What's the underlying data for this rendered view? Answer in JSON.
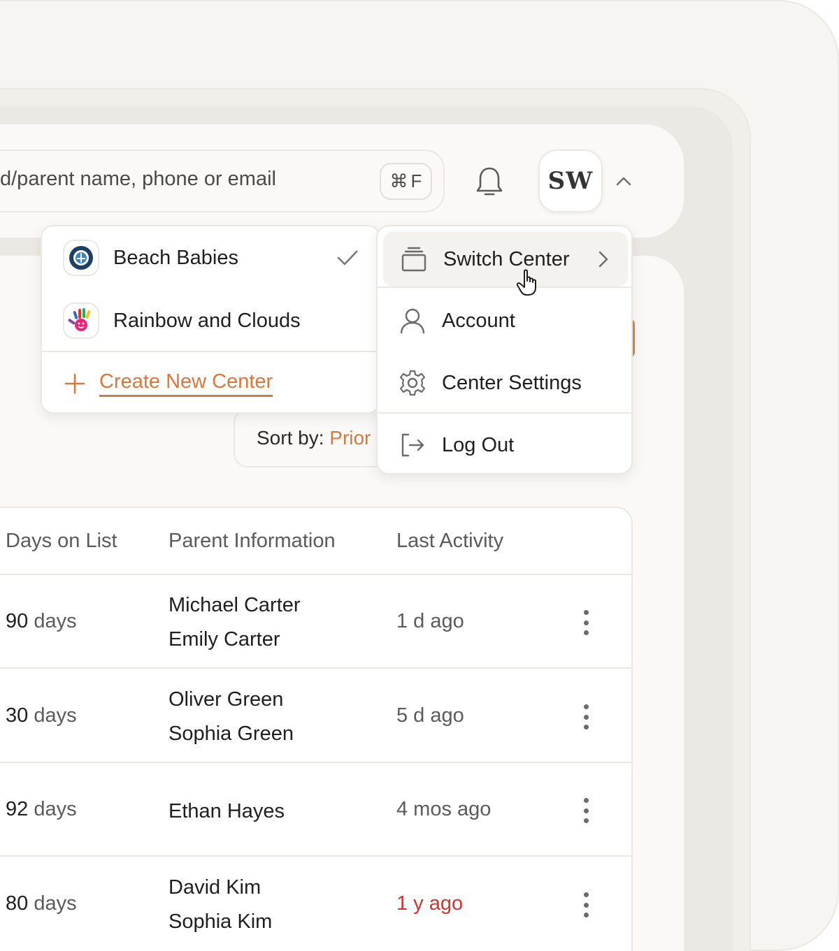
{
  "header": {
    "search_text": "d/parent name, phone or email",
    "shortcut_symbol": "⌘",
    "shortcut_key": "F",
    "avatar_initials": "SW"
  },
  "sort": {
    "label": "Sort by: ",
    "value": "Prior"
  },
  "centers_menu": {
    "items": [
      {
        "name": "Beach Babies",
        "selected": true
      },
      {
        "name": "Rainbow and Clouds",
        "selected": false
      }
    ],
    "create_label": "Create New Center"
  },
  "account_menu": {
    "items": [
      {
        "label": "Switch Center",
        "icon": "stack-icon",
        "active": true
      },
      {
        "label": "Account",
        "icon": "user-icon"
      },
      {
        "label": "Center Settings",
        "icon": "gear-icon"
      },
      {
        "label": "Log Out",
        "icon": "logout-icon"
      }
    ]
  },
  "table": {
    "columns": [
      "Days on List",
      "Parent Information",
      "Last Activity"
    ],
    "rows": [
      {
        "days": "90",
        "unit": "days",
        "parents": [
          "Michael Carter",
          "Emily Carter"
        ],
        "activity": "1 d ago"
      },
      {
        "days": "30",
        "unit": "days",
        "parents": [
          "Oliver Green",
          "Sophia Green"
        ],
        "activity": "5 d ago"
      },
      {
        "days": "92",
        "unit": "days",
        "parents": [
          "Ethan Hayes"
        ],
        "activity": "4 mos ago"
      },
      {
        "days": "80",
        "unit": "days",
        "parents": [
          "David Kim",
          "Sophia Kim"
        ],
        "activity": "1 y ago"
      }
    ]
  },
  "colors": {
    "accent": "#d9773c",
    "stale": "#d1342f",
    "border": "#ebe8e4"
  }
}
